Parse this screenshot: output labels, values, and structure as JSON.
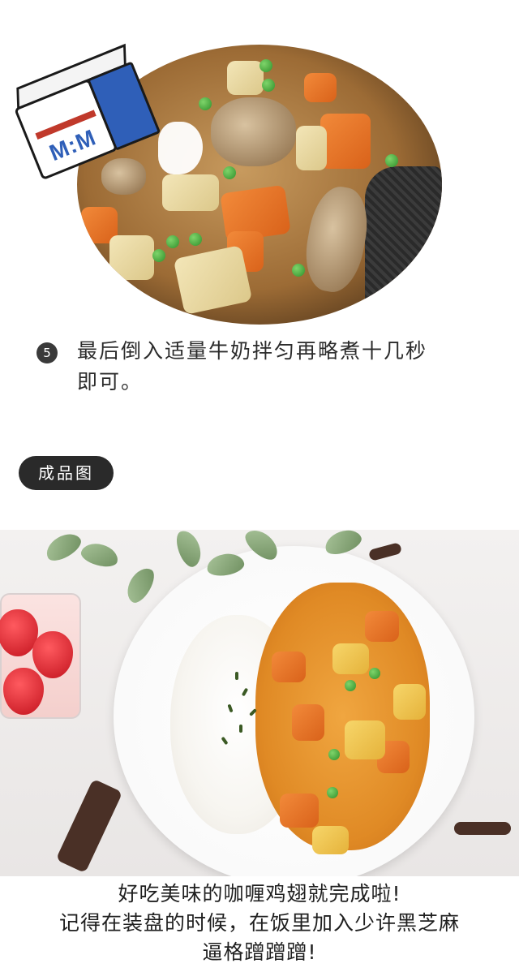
{
  "step": {
    "number": "5",
    "text_line1": "最后倒入适量牛奶拌匀再略煮十几秒",
    "text_line2": "即可。"
  },
  "milk_carton": {
    "logo": "M:M"
  },
  "section_tag": "成品图",
  "caption": {
    "line1": "好吃美味的咖喱鸡翅就完成啦!",
    "line2": "记得在装盘的时候，在饭里加入少许黑芝麻",
    "line3": "逼格蹭蹭蹭!"
  },
  "colors": {
    "tag_background": "#2a2a2a",
    "curry": "#e08a25",
    "carrot": "#f28a3a"
  }
}
